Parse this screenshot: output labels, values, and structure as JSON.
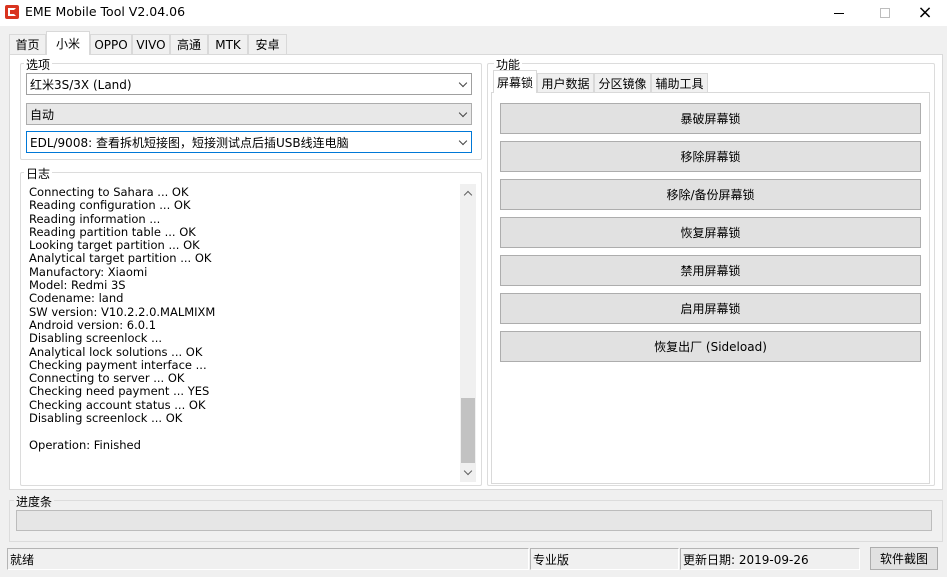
{
  "window": {
    "title": "EME Mobile Tool V2.04.06",
    "icon": "eme-logo-icon",
    "controls": {
      "minimize": "minimize-icon",
      "maximize": "maximize-icon",
      "close": "×"
    }
  },
  "main_tabs": [
    {
      "label": "首页",
      "active": false
    },
    {
      "label": "小米",
      "active": true
    },
    {
      "label": "OPPO",
      "active": false
    },
    {
      "label": "VIVO",
      "active": false
    },
    {
      "label": "高通",
      "active": false
    },
    {
      "label": "MTK",
      "active": false
    },
    {
      "label": "安卓",
      "active": false
    }
  ],
  "options": {
    "label": "选项",
    "model_select": "红米3S/3X (Land)",
    "mode_select": "自动",
    "connection_select": "EDL/9008: 查看拆机短接图，短接测试点后插USB线连电脑"
  },
  "log": {
    "label": "日志",
    "text": "Connecting to Sahara ... OK\nReading configuration ... OK\nReading information ...\nReading partition table ... OK\nLooking target partition ... OK\nAnalytical target partition ... OK\nManufactory: Xiaomi\nModel: Redmi 3S\nCodename: land\nSW version: V10.2.2.0.MALMIXM\nAndroid version: 6.0.1\nDisabling screenlock ...\nAnalytical lock solutions ... OK\nChecking payment interface ...\nConnecting to server ... OK\nChecking need payment ... YES\nChecking account status ... OK\nDisabling screenlock ... OK\n\nOperation: Finished"
  },
  "functions": {
    "label": "功能",
    "tabs": [
      {
        "label": "屏幕锁",
        "active": true
      },
      {
        "label": "用户数据",
        "active": false
      },
      {
        "label": "分区镜像",
        "active": false
      },
      {
        "label": "辅助工具",
        "active": false
      }
    ],
    "buttons": [
      "暴破屏幕锁",
      "移除屏幕锁",
      "移除/备份屏幕锁",
      "恢复屏幕锁",
      "禁用屏幕锁",
      "启用屏幕锁",
      "恢复出厂 (Sideload)"
    ]
  },
  "progress": {
    "label": "进度条",
    "value": 0
  },
  "status": {
    "state": "就绪",
    "edition": "专业版",
    "update_date": "更新日期: 2019-09-26",
    "screenshot_button": "软件截图"
  }
}
